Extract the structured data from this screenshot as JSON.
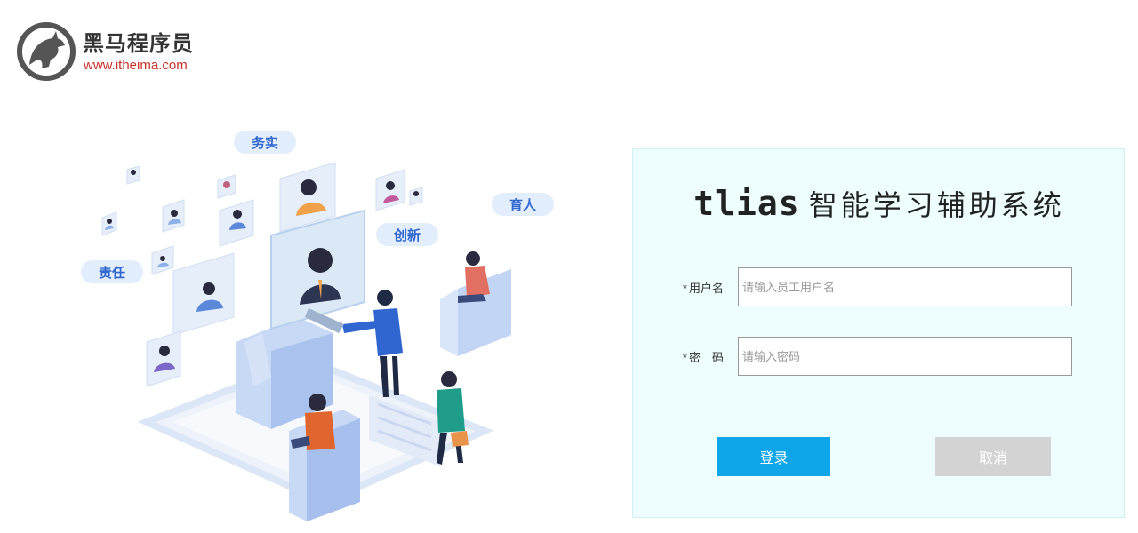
{
  "logo": {
    "name": "黑马程序员",
    "url": "www.itheima.com"
  },
  "illustration": {
    "tags": [
      "务实",
      "育人",
      "创新",
      "责任"
    ]
  },
  "login": {
    "title_en": "tlias",
    "title_zh": "智能学习辅助系统",
    "username": {
      "required_mark": "*",
      "label": "用户名",
      "placeholder": "请输入员工用户名",
      "value": ""
    },
    "password": {
      "required_mark": "*",
      "label": "密　码",
      "placeholder": "请输入密码",
      "value": ""
    },
    "login_button": "登录",
    "cancel_button": "取消"
  },
  "colors": {
    "brand_red": "#c8312a",
    "panel_bg": "#eefdfe",
    "primary_button": "#0ea5e9",
    "disabled_button": "#d3d3d3"
  }
}
